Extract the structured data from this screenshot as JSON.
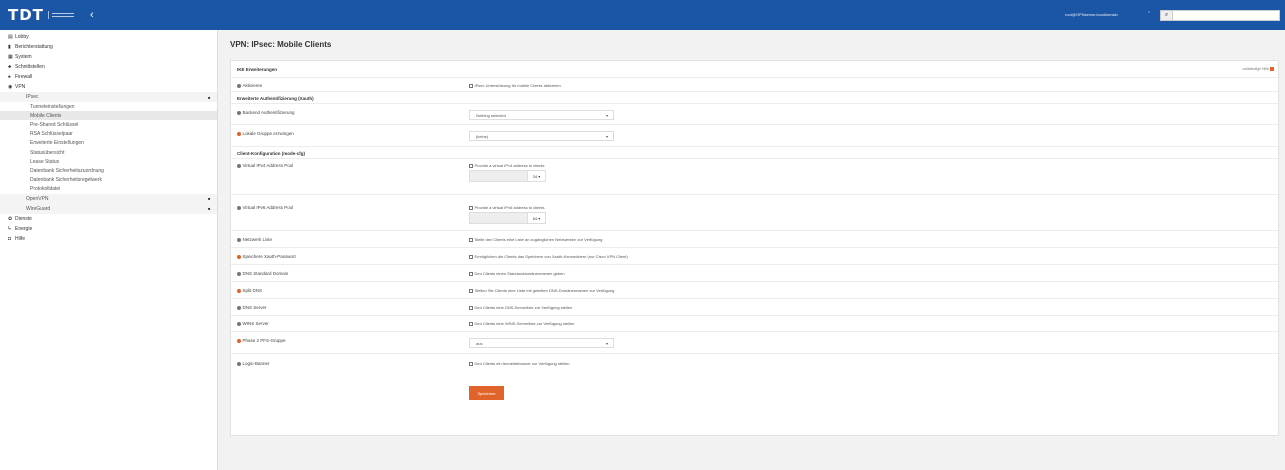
{
  "topbar": {
    "logo_text": "TDT",
    "collapse_icon": "‹",
    "user_text": "root@OPNsense.localdomain",
    "search_placeholder": ""
  },
  "sidebar": {
    "items": [
      {
        "label": "Lobby",
        "icon": "▤"
      },
      {
        "label": "Berichterstattung",
        "icon": "▮"
      },
      {
        "label": "System",
        "icon": "▦"
      },
      {
        "label": "Schnittstellen",
        "icon": "♣"
      },
      {
        "label": "Firewall",
        "icon": "♠"
      },
      {
        "label": "VPN",
        "icon": "◉"
      }
    ],
    "vpn_sub": {
      "ipsec": "IPsec",
      "openvpn": "OpenVPN",
      "wireguard": "WireGuard"
    },
    "ipsec_sub": [
      "Tunneleinstellungen",
      "Mobile Clients",
      "Pre-Shared Schlüssel",
      "RSA Schlüsselpaar",
      "Erweiterte Einstellungen",
      "Statusübersicht",
      "Lease Status",
      "Datenbank Sicherheitszuordnung",
      "Datenbank Sicherheitsregelwerk",
      "Protokolldatei"
    ],
    "bottom": [
      {
        "label": "Dienste",
        "icon": "✿"
      },
      {
        "label": "Energie",
        "icon": "ϟ"
      },
      {
        "label": "Hilfe",
        "icon": "◘"
      }
    ]
  },
  "page": {
    "title": "VPN: IPsec: Mobile Clients",
    "hilfe": "vollständige Hilfe",
    "sections": {
      "ike": "IKE Erweiterungen",
      "auth": "Erweiterte Authentifizierung (Xauth)",
      "client": "Client-Konfiguration (mode-cfg)"
    },
    "fields": {
      "aktivieren": {
        "label": "Aktivieren",
        "text": "IPsec Unterstützung für mobile Clients aktivieren"
      },
      "backend": {
        "label": "Backend Authentifizierung",
        "value": "Nothing selected"
      },
      "gruppe": {
        "label": "Lokale Gruppe erzwingen",
        "value": "(keine)"
      },
      "ipv4pool": {
        "label": "Virtual IPv4 Address Pool",
        "text": "Provide a virtual IPv4 address to clients",
        "mask": "24"
      },
      "ipv6pool": {
        "label": "Virtual IPv6 Address Pool",
        "text": "Provide a virtual IPv6 address to clients",
        "mask": "64"
      },
      "netzwerkliste": {
        "label": "Netzwerk Liste",
        "text": "Stelle den Clients eine Liste an zugänglichen Netzwerken zur Verfügung"
      },
      "speichernxauth": {
        "label": "Speichere Xauth-Passwort",
        "text": "Ermöglichen die Clients das Speichern von Xauth-Kennwörtern (nur Cisco VPN Client)"
      },
      "dnsdomain": {
        "label": "DNS Standard Domain",
        "text": "Den Clients einen Standarddomänennamen geben"
      },
      "splitdns": {
        "label": "Split DNS",
        "text": "Stellen Sie Clients eine Liste mit geteilten DNS-Domänennamen zur Verfügung"
      },
      "dnsserver": {
        "label": "DNS Server",
        "text": "Den Clients eine DNS-Serverliste zur Verfügung stellen"
      },
      "winsserver": {
        "label": "WINS Server",
        "text": "Den Clients eine WINS-Serverliste zur Verfügung stellen"
      },
      "pfs": {
        "label": "Phase 2 PFS-Gruppe",
        "value": "aus"
      },
      "banner": {
        "label": "Login-Banner",
        "text": "Den Clients ein Anmeldebanner zur Verfügung stellen"
      }
    },
    "save_label": "Speichern"
  },
  "colors": {
    "topbar": "#1a56a5",
    "accent": "#e0642a"
  }
}
